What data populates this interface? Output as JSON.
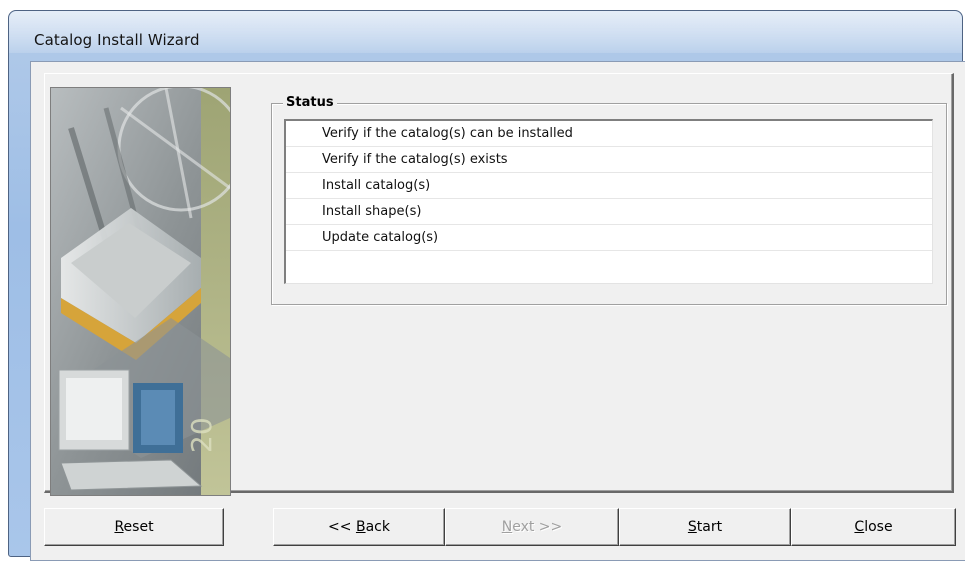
{
  "window": {
    "title": "Catalog Install Wizard"
  },
  "status": {
    "label": "Status",
    "items": [
      "Verify if the catalog(s) can be installed",
      "Verify if the catalog(s) exists",
      "Install catalog(s)",
      "Install shape(s)",
      "Update catalog(s)"
    ]
  },
  "buttons": {
    "reset": {
      "label": "Reset",
      "mnemonic": "R",
      "rest": "eset"
    },
    "back": {
      "pre": "<< ",
      "mnemonic": "B",
      "rest": "ack"
    },
    "next": {
      "mnemonic": "N",
      "rest": "ext >>"
    },
    "start": {
      "mnemonic": "S",
      "rest": "tart"
    },
    "close": {
      "mnemonic": "C",
      "rest": "lose"
    }
  }
}
